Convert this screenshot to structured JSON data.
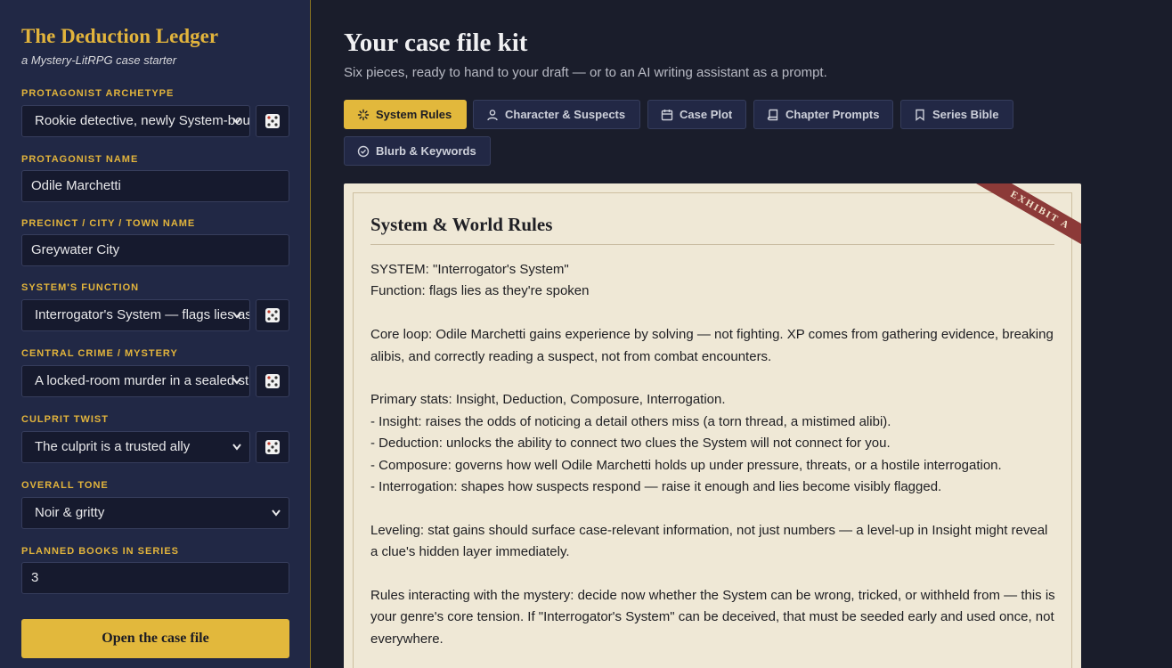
{
  "app": {
    "title": "The Deduction Ledger",
    "subtitle": "a Mystery-LitRPG case starter"
  },
  "form": {
    "archetype": {
      "label": "Protagonist archetype",
      "value": "Rookie detective, newly System-bound"
    },
    "name": {
      "label": "Protagonist name",
      "value": "Odile Marchetti"
    },
    "place": {
      "label": "Precinct / city / town name",
      "value": "Greywater City"
    },
    "function": {
      "label": "System's function",
      "value": "Interrogator's System — flags lies as they're spoken"
    },
    "crime": {
      "label": "Central crime / mystery",
      "value": "A locked-room murder in a sealed study"
    },
    "twist": {
      "label": "Culprit twist",
      "value": "The culprit is a trusted ally"
    },
    "tone": {
      "label": "Overall tone",
      "value": "Noir & gritty"
    },
    "books": {
      "label": "Planned books in series",
      "value": "3"
    },
    "submit_label": "Open the case file"
  },
  "main": {
    "title": "Your case file kit",
    "subtitle": "Six pieces, ready to hand to your draft — or to an AI writing assistant as a prompt."
  },
  "tabs": [
    {
      "label": "System Rules",
      "icon": "loader-icon",
      "active": true
    },
    {
      "label": "Character & Suspects",
      "icon": "person-icon",
      "active": false
    },
    {
      "label": "Case Plot",
      "icon": "calendar-icon",
      "active": false
    },
    {
      "label": "Chapter Prompts",
      "icon": "book-icon",
      "active": false
    },
    {
      "label": "Series Bible",
      "icon": "bookmark-icon",
      "active": false
    },
    {
      "label": "Blurb & Keywords",
      "icon": "check-circle-icon",
      "active": false
    }
  ],
  "document": {
    "ribbon": "EXHIBIT A",
    "title": "System & World Rules",
    "paragraphs": [
      [
        "SYSTEM: \"Interrogator's System\"",
        "Function: flags lies as they're spoken"
      ],
      [
        "Core loop: Odile Marchetti gains experience by solving — not fighting. XP comes from gathering evidence, breaking alibis, and correctly reading a suspect, not from combat encounters."
      ],
      [
        "Primary stats: Insight, Deduction, Composure, Interrogation.",
        "- Insight: raises the odds of noticing a detail others miss (a torn thread, a mistimed alibi).",
        "- Deduction: unlocks the ability to connect two clues the System will not connect for you.",
        "- Composure: governs how well Odile Marchetti holds up under pressure, threats, or a hostile interrogation.",
        "- Interrogation: shapes how suspects respond — raise it enough and lies become visibly flagged."
      ],
      [
        "Leveling: stat gains should surface case-relevant information, not just numbers — a level-up in Insight might reveal a clue's hidden layer immediately."
      ],
      [
        "Rules interacting with the mystery: decide now whether the System can be wrong, tricked, or withheld from — this is your genre's core tension. If \"Interrogator's System\" can be deceived, that must be seeded early and used once, not everywhere."
      ]
    ]
  },
  "colors": {
    "accent": "#e2b83c",
    "sidebar_bg": "#212845",
    "main_bg": "#1a1d2b",
    "paper_bg": "#efe8d6",
    "ribbon": "#8c3a38"
  }
}
